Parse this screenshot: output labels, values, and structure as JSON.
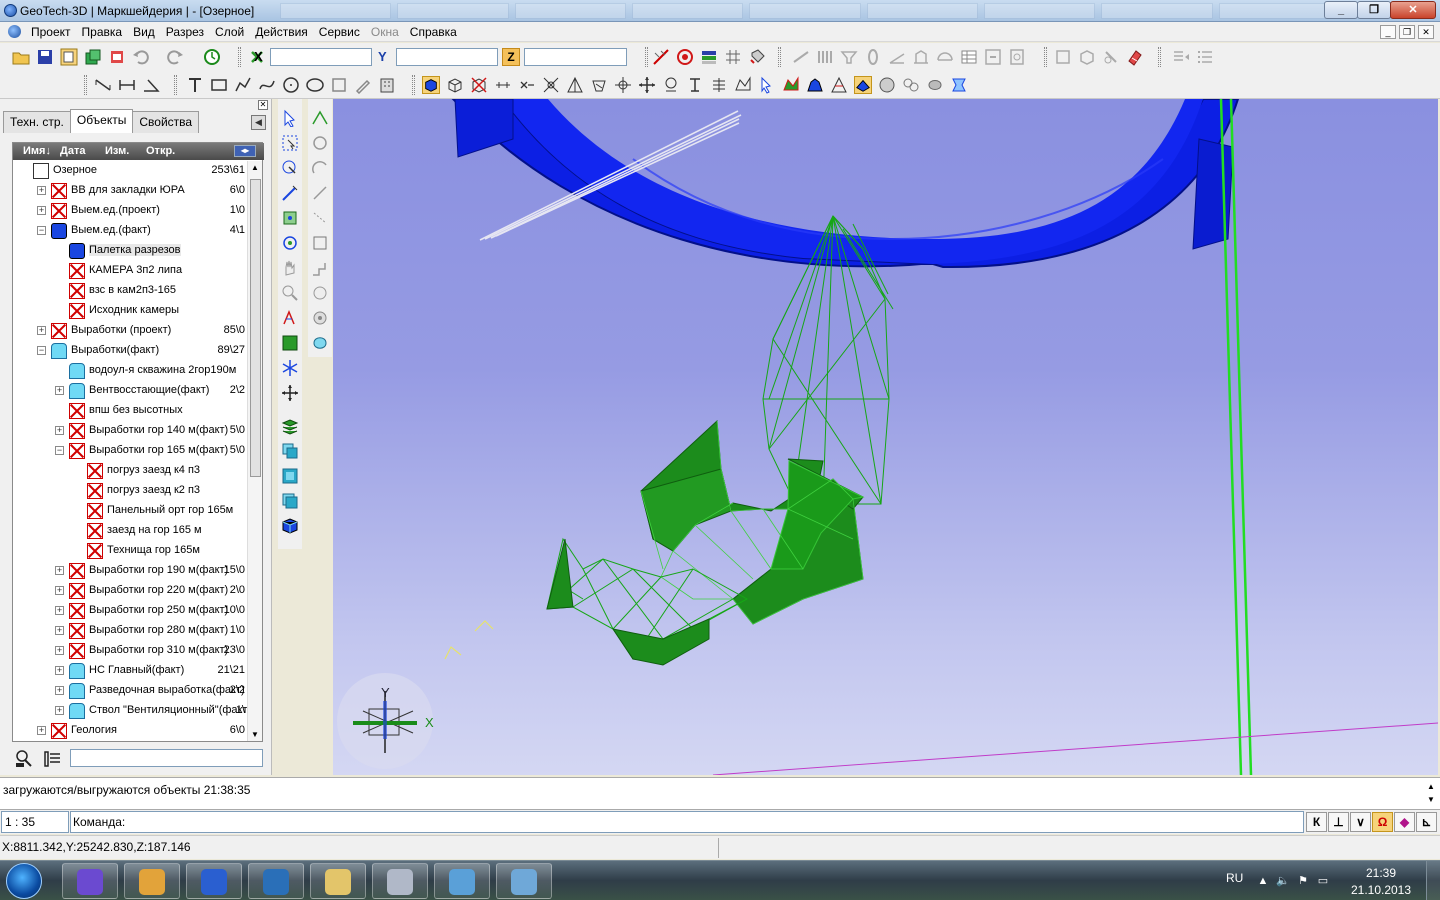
{
  "window": {
    "title": "GeoTech-3D | Маркшейдерия | - [Озерное]"
  },
  "menu": {
    "items": [
      "Проект",
      "Правка",
      "Вид",
      "Разрез",
      "Слой",
      "Действия",
      "Сервис",
      "Окна",
      "Справка"
    ],
    "disabled": [
      "Окна"
    ]
  },
  "coords_toolbar": {
    "x_label": "X",
    "y_label": "Y",
    "z_label": "Z",
    "x_value": "",
    "y_value": "",
    "z_value": ""
  },
  "panel": {
    "tabs": [
      "Техн. стр.",
      "Объекты",
      "Свойства"
    ],
    "active_tab": "Объекты",
    "columns": {
      "name": "Имя↓",
      "date": "Дата",
      "changed": "Изм.",
      "opened": "Откр."
    },
    "tree": [
      {
        "label": "Озерное",
        "count": "253\\61",
        "level": 0,
        "icon": "document-icon",
        "expander": ""
      },
      {
        "label": "ВВ для закладки ЮРА",
        "count": "6\\0",
        "level": 1,
        "icon": "hidden-layer-icon",
        "expander": "+"
      },
      {
        "label": "Выем.ед.(проект)",
        "count": "1\\0",
        "level": 1,
        "icon": "hidden-layer-icon",
        "expander": "+"
      },
      {
        "label": "Выем.ед.(факт)",
        "count": "4\\1",
        "level": 1,
        "icon": "block-layer-icon",
        "expander": "−"
      },
      {
        "label": "Палетка разрезов",
        "count": "",
        "level": 2,
        "icon": "block-layer-icon",
        "expander": "",
        "selected": true
      },
      {
        "label": "КАМЕРА 3п2 липа",
        "count": "",
        "level": 2,
        "icon": "hidden-layer-icon",
        "expander": ""
      },
      {
        "label": "взс в кам2п3-165",
        "count": "",
        "level": 2,
        "icon": "hidden-layer-icon",
        "expander": ""
      },
      {
        "label": "Исходник камеры",
        "count": "",
        "level": 2,
        "icon": "hidden-layer-icon",
        "expander": ""
      },
      {
        "label": "Выработки (проект)",
        "count": "85\\0",
        "level": 1,
        "icon": "hidden-layer-icon",
        "expander": "+"
      },
      {
        "label": "Выработки(факт)",
        "count": "89\\27",
        "level": 1,
        "icon": "workings-layer-icon",
        "expander": "−"
      },
      {
        "label": "водоул-я скважина 2гор190м",
        "count": "",
        "level": 2,
        "icon": "workings-layer-icon",
        "expander": ""
      },
      {
        "label": "Вентвосстающие(факт)",
        "count": "2\\2",
        "level": 2,
        "icon": "workings-layer-icon",
        "expander": "+"
      },
      {
        "label": "впш без высотных",
        "count": "",
        "level": 2,
        "icon": "hidden-layer-icon",
        "expander": ""
      },
      {
        "label": "Выработки гор 140 м(факт)",
        "count": "5\\0",
        "level": 2,
        "icon": "hidden-layer-icon",
        "expander": "+"
      },
      {
        "label": "Выработки гор 165 м(факт)",
        "count": "5\\0",
        "level": 2,
        "icon": "hidden-layer-icon",
        "expander": "−"
      },
      {
        "label": "погруз заезд к4 п3",
        "count": "",
        "level": 3,
        "icon": "hidden-layer-icon",
        "expander": ""
      },
      {
        "label": "погруз заезд к2 п3",
        "count": "",
        "level": 3,
        "icon": "hidden-layer-icon",
        "expander": ""
      },
      {
        "label": "Панельный орт гор 165м",
        "count": "",
        "level": 3,
        "icon": "hidden-layer-icon",
        "expander": ""
      },
      {
        "label": "заезд на гор 165 м",
        "count": "",
        "level": 3,
        "icon": "hidden-layer-icon",
        "expander": ""
      },
      {
        "label": "Технища гор 165м",
        "count": "",
        "level": 3,
        "icon": "hidden-layer-icon",
        "expander": ""
      },
      {
        "label": "Выработки гор 190 м(факт)",
        "count": "15\\0",
        "level": 2,
        "icon": "hidden-layer-icon",
        "expander": "+"
      },
      {
        "label": "Выработки гор 220 м(факт)",
        "count": "2\\0",
        "level": 2,
        "icon": "hidden-layer-icon",
        "expander": "+"
      },
      {
        "label": "Выработки гор 250 м(факт)",
        "count": "10\\0",
        "level": 2,
        "icon": "hidden-layer-icon",
        "expander": "+"
      },
      {
        "label": "Выработки гор 280 м(факт)",
        "count": "1\\0",
        "level": 2,
        "icon": "hidden-layer-icon",
        "expander": "+"
      },
      {
        "label": "Выработки гор 310 м(факт)",
        "count": "23\\0",
        "level": 2,
        "icon": "hidden-layer-icon",
        "expander": "+"
      },
      {
        "label": "НС Главный(факт)",
        "count": "21\\21",
        "level": 2,
        "icon": "workings-layer-icon",
        "expander": "+"
      },
      {
        "label": "Разведочная выработка(факт)",
        "count": "2\\2",
        "level": 2,
        "icon": "workings-layer-icon",
        "expander": "+"
      },
      {
        "label": "Ствол \"Вентиляционный\"(факт)",
        "count": "1\\",
        "level": 2,
        "icon": "workings-layer-icon",
        "expander": "+"
      },
      {
        "label": "Геология",
        "count": "6\\0",
        "level": 1,
        "icon": "hidden-layer-icon",
        "expander": "+"
      }
    ],
    "search_value": ""
  },
  "viewport": {
    "axis_x": "X",
    "axis_y": "Y",
    "colors": {
      "orebody": "#0a1ee6",
      "wireframe": "#16a616",
      "surface": "#1c8c1c",
      "shaft": "#22dd22"
    }
  },
  "status": {
    "message": "загружаются/выгружаются объекты 21:38:35"
  },
  "command": {
    "scale": "1 : 35",
    "prompt": "Команда:",
    "snap_buttons": [
      "К",
      "⊥",
      "∨",
      "Ω",
      "◆",
      "⊾"
    ]
  },
  "coord_status": {
    "text": "X:8811.342,Y:25242.830,Z:187.146"
  },
  "taskbar": {
    "language": "RU",
    "time": "21:39",
    "date": "21.10.2013",
    "apps": [
      "visual-studio-icon",
      "chrome-icon",
      "geotech-icon",
      "phone-book-icon",
      "file-manager-icon",
      "calculator-icon",
      "paint-icon",
      "screen-capture-icon"
    ]
  }
}
